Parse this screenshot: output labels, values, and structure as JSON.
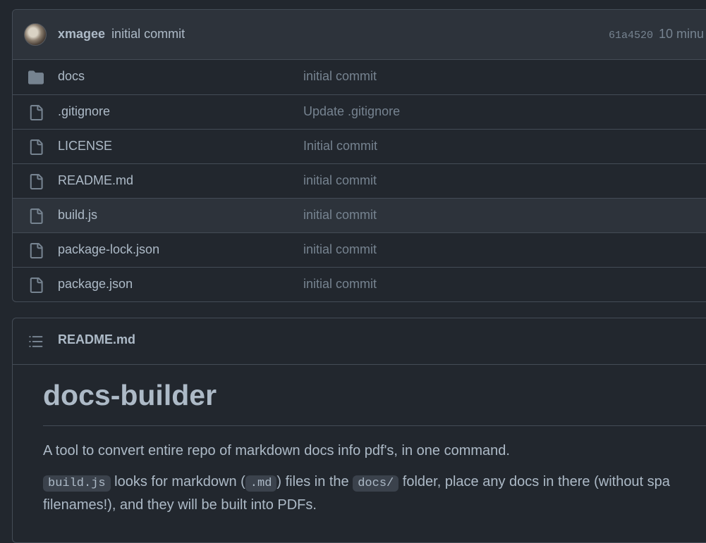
{
  "commit": {
    "author": "xmagee",
    "message": "initial commit",
    "sha": "61a4520",
    "time": "10 minu"
  },
  "files": [
    {
      "type": "folder",
      "name": "docs",
      "commit": "initial commit"
    },
    {
      "type": "file",
      "name": ".gitignore",
      "commit": "Update .gitignore"
    },
    {
      "type": "file",
      "name": "LICENSE",
      "commit": "Initial commit"
    },
    {
      "type": "file",
      "name": "README.md",
      "commit": "initial commit"
    },
    {
      "type": "file",
      "name": "build.js",
      "commit": "initial commit",
      "hovered": true
    },
    {
      "type": "file",
      "name": "package-lock.json",
      "commit": "initial commit"
    },
    {
      "type": "file",
      "name": "package.json",
      "commit": "initial commit"
    }
  ],
  "readme": {
    "header": "README.md",
    "title": "docs-builder",
    "p1": "A tool to convert entire repo of markdown docs info pdf's, in one command.",
    "p2": {
      "code1": "build.js",
      "t1": " looks for markdown (",
      "code2": ".md",
      "t2": ") files in the ",
      "code3": "docs/",
      "t3": " folder, place any docs in there (without spa",
      "line2": "filenames!), and they will be built into PDFs."
    }
  },
  "colors": {
    "background": "#22272e",
    "header_bg": "#2d333b",
    "border": "#444c56",
    "text": "#adbac7",
    "muted": "#768390",
    "folder_icon": "#768390"
  }
}
